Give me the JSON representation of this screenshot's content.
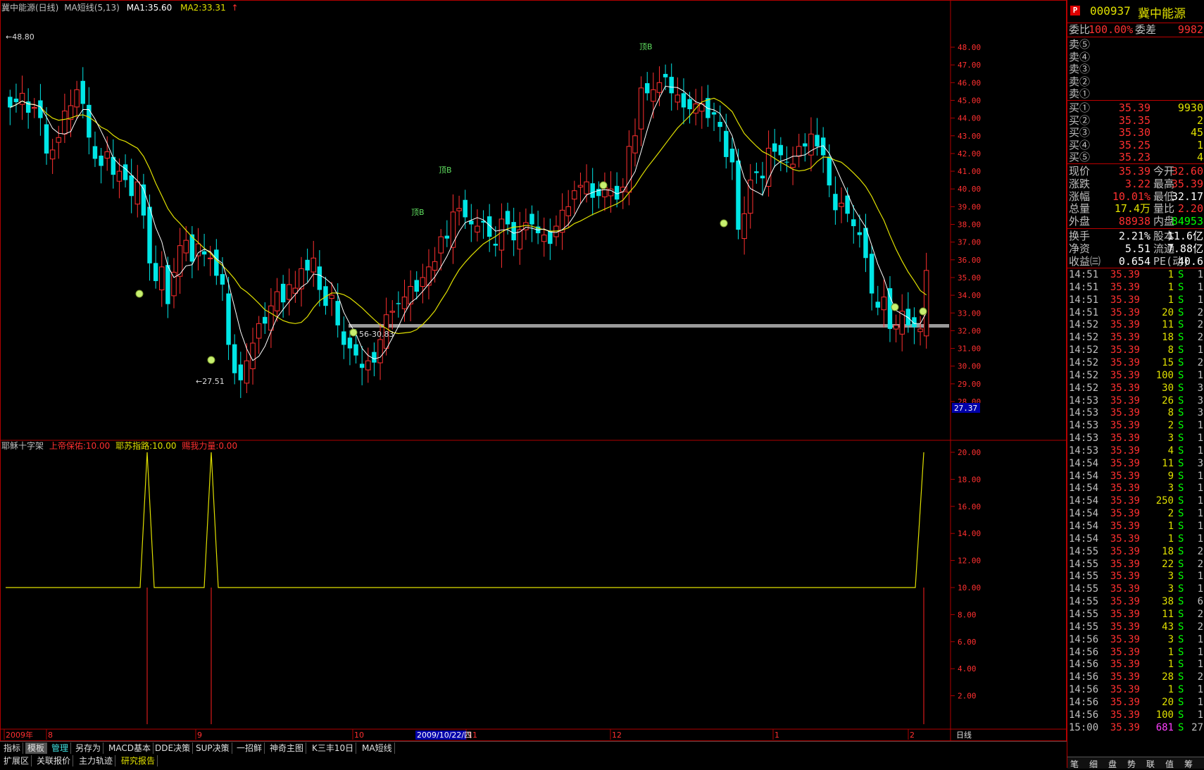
{
  "main": {
    "title": "冀中能源(日线)",
    "indicator": "MA短线(5,13)",
    "ma1": "MA1:35.60",
    "ma2": "MA2:33.31",
    "max_label": "48.80",
    "min_label": "27.51",
    "range_label": "56-30.83",
    "mark_label": "顶B",
    "price_scale": [
      "48.00",
      "47.00",
      "46.00",
      "45.00",
      "44.00",
      "43.00",
      "42.00",
      "41.00",
      "40.00",
      "39.00",
      "38.00",
      "37.00",
      "36.00",
      "35.00",
      "34.00",
      "33.00",
      "32.00",
      "31.00",
      "30.00",
      "29.00",
      "28.00"
    ],
    "cursor_price": "27.37",
    "colors": {
      "up": "#ff3030",
      "down": "#00e6e6",
      "ma1": "#ffffff",
      "ma2": "#e0e000",
      "grid": "#b00000"
    }
  },
  "sub": {
    "name": "耶稣十字架",
    "v1": "上帝保佑:10.00",
    "v2": "耶苏指路:10.00",
    "v3": "赐我力量:0.00",
    "scale": [
      "20.00",
      "18.00",
      "16.00",
      "14.00",
      "12.00",
      "10.00",
      "8.00",
      "6.00",
      "4.00",
      "2.00"
    ]
  },
  "xaxis": {
    "labels": [
      "2009年",
      "8",
      "9",
      "10",
      "11",
      "12",
      "1",
      "2"
    ],
    "cursor_date": "2009/10/22/四",
    "period": "日线"
  },
  "bottom_bar": {
    "row1": [
      "指标",
      "模板",
      "管理",
      "另存为",
      "MACD基本",
      "DDE决策",
      "SUP决策",
      "一招鲜",
      "神奇主图",
      "K三丰10日",
      "MA短线"
    ],
    "row2": [
      "扩展区",
      "关联报价",
      "主力轨迹",
      "研究报告"
    ]
  },
  "quote": {
    "code": "000937",
    "name": "冀中能源",
    "p_icon": "P",
    "wei_bi_label": "委比",
    "wei_bi": "100.00%",
    "wei_cha_label": "委差",
    "wei_cha": "9982",
    "sell": [
      {
        "label": "卖⑤"
      },
      {
        "label": "卖④"
      },
      {
        "label": "卖③"
      },
      {
        "label": "卖②"
      },
      {
        "label": "卖①"
      }
    ],
    "buy": [
      {
        "label": "买①",
        "price": "35.39",
        "vol": "9930"
      },
      {
        "label": "买②",
        "price": "35.35",
        "vol": "2"
      },
      {
        "label": "买③",
        "price": "35.30",
        "vol": "45"
      },
      {
        "label": "买④",
        "price": "35.25",
        "vol": "1"
      },
      {
        "label": "买⑤",
        "price": "35.23",
        "vol": "4"
      }
    ],
    "stats": [
      {
        "l1": "现价",
        "v1": "35.39",
        "l2": "今开",
        "v2": "32.60"
      },
      {
        "l1": "涨跌",
        "v1": "3.22",
        "l2": "最高",
        "v2": "35.39"
      },
      {
        "l1": "涨幅",
        "v1": "10.01%",
        "l2": "最低",
        "v2": "32.17"
      },
      {
        "l1": "总量",
        "v1": "17.4万",
        "l2": "量比",
        "v2": "2.20"
      },
      {
        "l1": "外盘",
        "v1": "88938",
        "l2": "内盘",
        "v2": "84953"
      }
    ],
    "stats2": [
      {
        "l1": "换手",
        "v1": "2.21%",
        "l2": "股本",
        "v2": "11.6亿"
      },
      {
        "l1": "净资",
        "v1": "5.51",
        "l2": "流通",
        "v2": "7.88亿"
      },
      {
        "l1": "收益㈢",
        "v1": "0.654",
        "l2": "PE(动)",
        "v2": "40.6"
      }
    ],
    "ticks": [
      [
        "14:51",
        "35.39",
        "1",
        "S",
        "1"
      ],
      [
        "14:51",
        "35.39",
        "1",
        "S",
        "1"
      ],
      [
        "14:51",
        "35.39",
        "1",
        "S",
        "1"
      ],
      [
        "14:51",
        "35.39",
        "20",
        "S",
        "2"
      ],
      [
        "14:52",
        "35.39",
        "11",
        "S",
        "2"
      ],
      [
        "14:52",
        "35.39",
        "18",
        "S",
        "2"
      ],
      [
        "14:52",
        "35.39",
        "8",
        "S",
        "1"
      ],
      [
        "14:52",
        "35.39",
        "15",
        "S",
        "2"
      ],
      [
        "14:52",
        "35.39",
        "100",
        "S",
        "1"
      ],
      [
        "14:52",
        "35.39",
        "30",
        "S",
        "3"
      ],
      [
        "14:53",
        "35.39",
        "26",
        "S",
        "3"
      ],
      [
        "14:53",
        "35.39",
        "8",
        "S",
        "3"
      ],
      [
        "14:53",
        "35.39",
        "2",
        "S",
        "1"
      ],
      [
        "14:53",
        "35.39",
        "3",
        "S",
        "1"
      ],
      [
        "14:53",
        "35.39",
        "4",
        "S",
        "1"
      ],
      [
        "14:54",
        "35.39",
        "11",
        "S",
        "3"
      ],
      [
        "14:54",
        "35.39",
        "9",
        "S",
        "1"
      ],
      [
        "14:54",
        "35.39",
        "3",
        "S",
        "1"
      ],
      [
        "14:54",
        "35.39",
        "250",
        "S",
        "1"
      ],
      [
        "14:54",
        "35.39",
        "2",
        "S",
        "1"
      ],
      [
        "14:54",
        "35.39",
        "1",
        "S",
        "1"
      ],
      [
        "14:54",
        "35.39",
        "1",
        "S",
        "1"
      ],
      [
        "14:55",
        "35.39",
        "18",
        "S",
        "2"
      ],
      [
        "14:55",
        "35.39",
        "22",
        "S",
        "2"
      ],
      [
        "14:55",
        "35.39",
        "3",
        "S",
        "1"
      ],
      [
        "14:55",
        "35.39",
        "3",
        "S",
        "1"
      ],
      [
        "14:55",
        "35.39",
        "38",
        "S",
        "6"
      ],
      [
        "14:55",
        "35.39",
        "11",
        "S",
        "2"
      ],
      [
        "14:55",
        "35.39",
        "43",
        "S",
        "2"
      ],
      [
        "14:56",
        "35.39",
        "3",
        "S",
        "1"
      ],
      [
        "14:56",
        "35.39",
        "1",
        "S",
        "1"
      ],
      [
        "14:56",
        "35.39",
        "1",
        "S",
        "1"
      ],
      [
        "14:56",
        "35.39",
        "28",
        "S",
        "2"
      ],
      [
        "14:56",
        "35.39",
        "1",
        "S",
        "1"
      ],
      [
        "14:56",
        "35.39",
        "20",
        "S",
        "1"
      ],
      [
        "14:56",
        "35.39",
        "100",
        "S",
        "1"
      ],
      [
        "15:00",
        "35.39",
        "681",
        "S",
        "27"
      ]
    ],
    "bottom_tabs": [
      "笔",
      "细",
      "盘",
      "势",
      "联",
      "值",
      "筹"
    ]
  }
}
